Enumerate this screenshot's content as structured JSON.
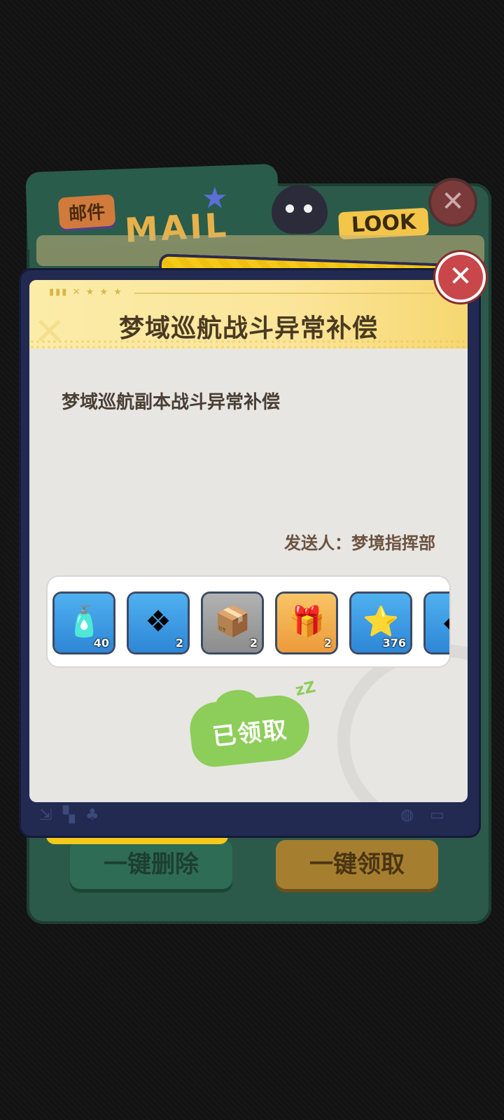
{
  "background": {
    "tab_label": "邮件",
    "word": "MAIL",
    "look_label": "LOOK",
    "close_symbol": "✕",
    "delete_all_label": "一键删除",
    "claim_all_label": "一键领取"
  },
  "dialog": {
    "title": "梦域巡航战斗异常补偿",
    "body": "梦域巡航副本战斗异常补偿",
    "sender": "发送人：梦境指挥部",
    "claimed_label": "已领取",
    "close_symbol": "✕"
  },
  "rewards": [
    {
      "icon": "potion-bottle-icon",
      "glyph": "🧴",
      "count": "40",
      "bg": "blue"
    },
    {
      "icon": "blue-crystal-icon",
      "glyph": "❖",
      "count": "2",
      "bg": "blue"
    },
    {
      "icon": "mystery-box-icon",
      "glyph": "📦",
      "count": "2",
      "bg": "gray"
    },
    {
      "icon": "red-gift-box-icon",
      "glyph": "🎁",
      "count": "2",
      "bg": "gold"
    },
    {
      "icon": "gold-coin-icon",
      "glyph": "⭐",
      "count": "376",
      "bg": "blue"
    },
    {
      "icon": "crystal-shard-icon",
      "glyph": "◆",
      "count": "",
      "bg": "blue"
    }
  ],
  "colors": {
    "accent_gold": "#fbe59a",
    "close_red": "#c9474a",
    "claimed_green": "#8dcd59",
    "dialog_navy": "#222a52"
  }
}
